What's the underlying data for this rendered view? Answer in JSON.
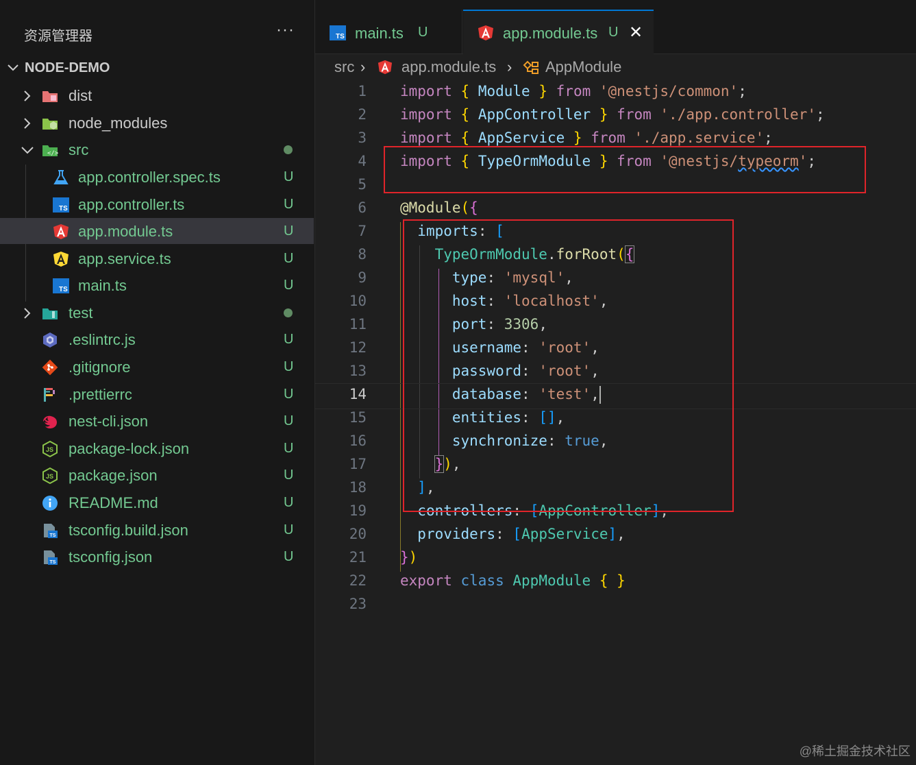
{
  "explorer": {
    "title": "资源管理器",
    "more": "···",
    "project": "NODE-DEMO",
    "items": [
      {
        "name": "dist",
        "icon": "folder-dist-icon",
        "type": "folder",
        "expanded": false,
        "status": ""
      },
      {
        "name": "node_modules",
        "icon": "folder-node-icon",
        "type": "folder",
        "expanded": false,
        "status": ""
      },
      {
        "name": "src",
        "icon": "folder-src-icon",
        "type": "folder",
        "expanded": true,
        "status": "dot"
      },
      {
        "name": "app.controller.spec.ts",
        "icon": "test-flask-icon",
        "status": "U"
      },
      {
        "name": "app.controller.ts",
        "icon": "typescript-icon",
        "status": "U"
      },
      {
        "name": "app.module.ts",
        "icon": "angular-icon",
        "status": "U"
      },
      {
        "name": "app.service.ts",
        "icon": "angular-service-icon",
        "status": "U"
      },
      {
        "name": "main.ts",
        "icon": "typescript-icon",
        "status": "U"
      },
      {
        "name": "test",
        "icon": "folder-test-icon",
        "type": "folder",
        "expanded": false,
        "status": "dot"
      },
      {
        "name": ".eslintrc.js",
        "icon": "eslint-icon",
        "status": "U"
      },
      {
        "name": ".gitignore",
        "icon": "git-icon",
        "status": "U"
      },
      {
        "name": ".prettierrc",
        "icon": "prettier-icon",
        "status": "U"
      },
      {
        "name": "nest-cli.json",
        "icon": "nest-icon",
        "status": "U"
      },
      {
        "name": "package-lock.json",
        "icon": "nodejs-icon",
        "status": "U"
      },
      {
        "name": "package.json",
        "icon": "nodejs-icon",
        "status": "U"
      },
      {
        "name": "README.md",
        "icon": "info-icon",
        "status": "U"
      },
      {
        "name": "tsconfig.build.json",
        "icon": "tsconfig-icon",
        "status": "U"
      },
      {
        "name": "tsconfig.json",
        "icon": "tsconfig-icon",
        "status": "U"
      }
    ]
  },
  "tabs": [
    {
      "label": "main.ts",
      "status": "U",
      "active": false
    },
    {
      "label": "app.module.ts",
      "status": "U",
      "active": true,
      "close": "✕"
    }
  ],
  "breadcrumb": {
    "folder": "src",
    "file": "app.module.ts",
    "symbol": "AppModule",
    "sep": "›"
  },
  "editor": {
    "current_line": 14,
    "line_numbers": [
      "1",
      "2",
      "3",
      "4",
      "5",
      "6",
      "7",
      "8",
      "9",
      "10",
      "11",
      "12",
      "13",
      "14",
      "15",
      "16",
      "17",
      "18",
      "19",
      "20",
      "21",
      "22",
      "23"
    ]
  },
  "colors": {
    "highlight_box": "#e0242a",
    "modified": "#73c991",
    "accent": "#0078d4"
  },
  "watermark": "@稀土掘金技术社区"
}
